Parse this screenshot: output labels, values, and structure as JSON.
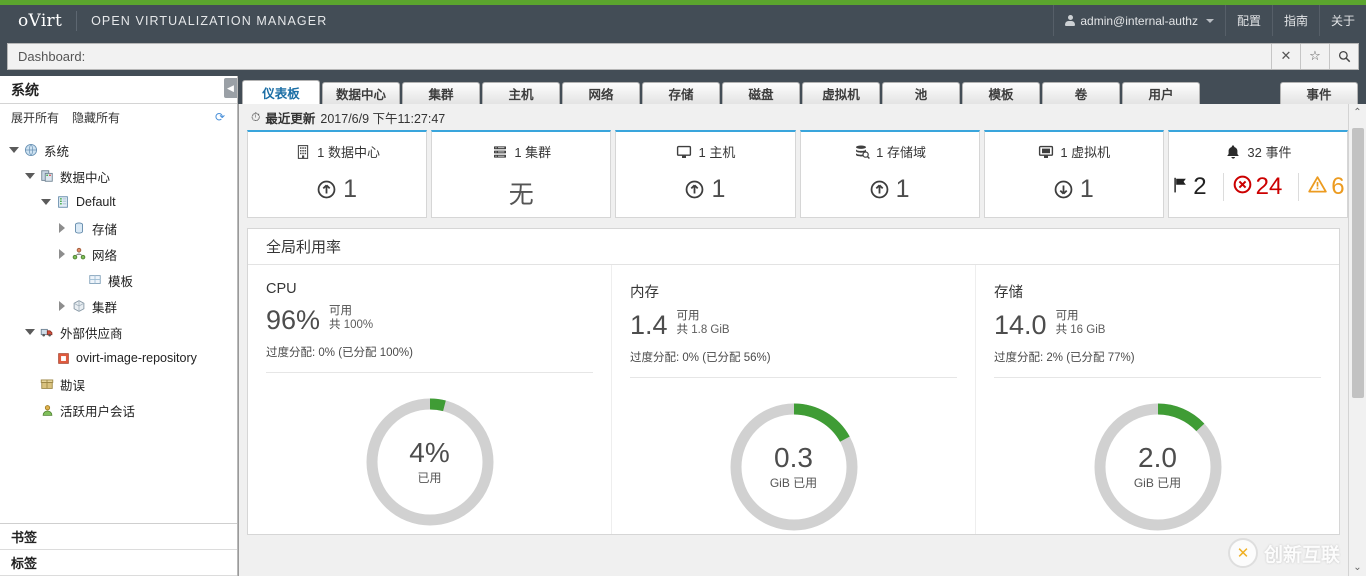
{
  "header": {
    "brand": "oVirt",
    "product": "OPEN VIRTUALIZATION MANAGER",
    "user": "admin@internal-authz",
    "user_icon": "user-icon",
    "caret_icon": "chevron-down-icon",
    "menu": [
      {
        "label": "配置"
      },
      {
        "label": "指南"
      },
      {
        "label": "关于"
      }
    ],
    "accent_green": "#5ba52e",
    "bar_color": "#434d56"
  },
  "search": {
    "value": "Dashboard:",
    "placeholder": "Dashboard:",
    "buttons": [
      {
        "name": "clear-search-button",
        "glyph": "✕"
      },
      {
        "name": "bookmark-search-button",
        "glyph": "☆"
      },
      {
        "name": "search-button",
        "glyph": "🔍"
      }
    ]
  },
  "sidebar": {
    "title": "系统",
    "collapse_glyph": "◀",
    "expand_all": "展开所有",
    "collapse_all": "隐藏所有",
    "refresh_glyph": "⟳",
    "tree": [
      {
        "label": "系统",
        "indent": 0,
        "toggle": "down",
        "icon": "globe-icon"
      },
      {
        "label": "数据中心",
        "indent": 1,
        "toggle": "down",
        "icon": "datacenter-icon"
      },
      {
        "label": "Default",
        "indent": 2,
        "toggle": "down",
        "icon": "cluster-stack-icon"
      },
      {
        "label": "存储",
        "indent": 3,
        "toggle": "right",
        "icon": "storage-icon"
      },
      {
        "label": "网络",
        "indent": 3,
        "toggle": "right",
        "icon": "network-icon"
      },
      {
        "label": "模板",
        "indent": 4,
        "toggle": "none",
        "icon": "template-icon"
      },
      {
        "label": "集群",
        "indent": 3,
        "toggle": "right",
        "icon": "cube-icon"
      },
      {
        "label": "外部供应商",
        "indent": 1,
        "toggle": "down",
        "icon": "provider-icon"
      },
      {
        "label": "ovirt-image-repository",
        "indent": 2,
        "toggle": "none",
        "icon": "repository-icon"
      },
      {
        "label": "勘误",
        "indent": 1,
        "toggle": "none",
        "icon": "errata-icon"
      },
      {
        "label": "活跃用户会话",
        "indent": 1,
        "toggle": "none",
        "icon": "user-session-icon"
      }
    ],
    "bottom": [
      {
        "label": "书签"
      },
      {
        "label": "标签"
      }
    ]
  },
  "tabs": [
    {
      "label": "仪表板",
      "active": true
    },
    {
      "label": "数据中心",
      "active": false
    },
    {
      "label": "集群",
      "active": false
    },
    {
      "label": "主机",
      "active": false
    },
    {
      "label": "网络",
      "active": false
    },
    {
      "label": "存储",
      "active": false
    },
    {
      "label": "磁盘",
      "active": false
    },
    {
      "label": "虚拟机",
      "active": false
    },
    {
      "label": "池",
      "active": false
    },
    {
      "label": "模板",
      "active": false
    },
    {
      "label": "卷",
      "active": false
    },
    {
      "label": "用户",
      "active": false
    }
  ],
  "tab_right": {
    "label": "事件"
  },
  "dashboard": {
    "updated_label": "最近更新",
    "updated_value": "2017/6/9 下午11:27:47",
    "clock_glyph": "⏱",
    "cards": [
      {
        "name": "datacenters",
        "title": "1 数据中心",
        "icon": "building-icon",
        "status_icon": "arrow-up-circle-icon",
        "status_value": "1",
        "status_kind": "up"
      },
      {
        "name": "clusters",
        "title": "1 集群",
        "icon": "server-rack-icon",
        "status_icon": "none",
        "status_value": "无",
        "status_kind": "none"
      },
      {
        "name": "hosts",
        "title": "1 主机",
        "icon": "monitor-icon",
        "status_icon": "arrow-up-circle-icon",
        "status_value": "1",
        "status_kind": "up"
      },
      {
        "name": "storage-domains",
        "title": "1 存储域",
        "icon": "database-search-icon",
        "status_icon": "arrow-up-circle-icon",
        "status_value": "1",
        "status_kind": "up"
      },
      {
        "name": "virtual-machines",
        "title": "1 虚拟机",
        "icon": "vm-monitor-icon",
        "status_icon": "arrow-down-circle-icon",
        "status_value": "1",
        "status_kind": "down"
      }
    ],
    "events_card": {
      "name": "events",
      "title": "32 事件",
      "icon": "bell-icon",
      "segments": [
        {
          "icon": "flag-icon",
          "value": "2",
          "color": "#222222"
        },
        {
          "icon": "error-circle-icon",
          "value": "24",
          "color": "#cc0000"
        },
        {
          "icon": "warning-triangle-icon",
          "value": "6",
          "color": "#ec9b20"
        }
      ]
    },
    "utilization": {
      "heading": "全局利用率",
      "columns": [
        {
          "name": "cpu",
          "title": "CPU",
          "value": "96%",
          "available_label": "可用",
          "total_label": "共",
          "total_value": "100%",
          "overcommit": "过度分配: 0% (已分配 100%)",
          "donut_value": "4%",
          "donut_label": "已用",
          "donut_percent": 4
        },
        {
          "name": "memory",
          "title": "内存",
          "value": "1.4",
          "available_label": "可用",
          "total_label": "共",
          "total_value": "1.8 GiB",
          "overcommit": "过度分配: 0% (已分配 56%)",
          "donut_value": "0.3",
          "donut_label": "GiB 已用",
          "donut_percent": 17
        },
        {
          "name": "storage",
          "title": "存储",
          "value": "14.0",
          "available_label": "可用",
          "total_label": "共",
          "total_value": "16 GiB",
          "overcommit": "过度分配: 2% (已分配 77%)",
          "donut_value": "2.0",
          "donut_label": "GiB 已用",
          "donut_percent": 13
        }
      ],
      "donut_used_color": "#3f9c35",
      "donut_track_color": "#d1d1d1"
    }
  },
  "scrollbar": {
    "up_glyph": "⌃",
    "down_glyph": "⌄"
  },
  "watermark": {
    "text": "创新互联"
  },
  "chart_data": [
    {
      "type": "pie",
      "title": "CPU",
      "categories": [
        "已用",
        "可用"
      ],
      "values": [
        4,
        96
      ],
      "unit": "%",
      "center_value": "4%",
      "center_label": "已用"
    },
    {
      "type": "pie",
      "title": "内存",
      "categories": [
        "已用",
        "可用"
      ],
      "values": [
        0.3,
        1.5
      ],
      "unit": "GiB",
      "center_value": "0.3",
      "center_label": "GiB 已用"
    },
    {
      "type": "pie",
      "title": "存储",
      "categories": [
        "已用",
        "可用"
      ],
      "values": [
        2.0,
        14.0
      ],
      "unit": "GiB",
      "center_value": "2.0",
      "center_label": "GiB 已用"
    }
  ]
}
